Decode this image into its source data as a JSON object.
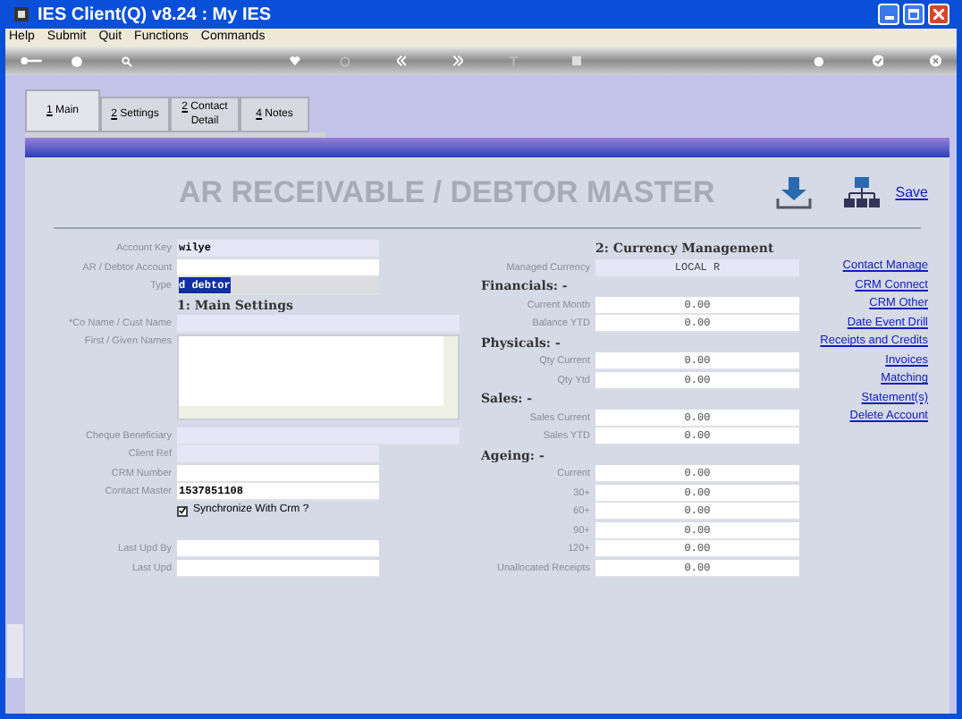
{
  "window": {
    "title": "IES Client(Q) v8.24 : My IES"
  },
  "menu": [
    "Help",
    "Submit",
    "Quit",
    "Functions",
    "Commands"
  ],
  "tabs": [
    {
      "label": "1 Main",
      "selected": true
    },
    {
      "label": "2 Settings",
      "selected": false
    },
    {
      "label": "2 Contact Detail",
      "selected": false
    },
    {
      "label": "4 Notes",
      "selected": false
    }
  ],
  "header": {
    "title": "AR RECEIVABLE / DEBTOR MASTER",
    "save_link": "Save"
  },
  "left_rows": [
    {
      "kind": "field",
      "label": "Account Key",
      "value": "wilye",
      "shaded": true
    },
    {
      "kind": "field",
      "label": "AR / Debtor Account",
      "value": "",
      "shaded": false
    },
    {
      "kind": "field",
      "label": "Type",
      "value": "d debtor",
      "shaded": false,
      "highlighted": true
    },
    {
      "kind": "heading",
      "label": "1: Main Settings"
    },
    {
      "kind": "field",
      "label": "*Co Name / Cust Name",
      "value": "",
      "shaded": true,
      "wide": true
    },
    {
      "kind": "textarea",
      "label": "First / Given Names"
    },
    {
      "kind": "field",
      "label": "Cheque Beneficiary",
      "value": "",
      "shaded": true,
      "wide": true
    },
    {
      "kind": "field",
      "label": "Client Ref",
      "value": "",
      "shaded": true
    },
    {
      "kind": "field",
      "label": "CRM Number",
      "value": "",
      "shaded": false
    },
    {
      "kind": "field",
      "label": "Contact Master",
      "value": "1537851108",
      "shaded": false
    },
    {
      "kind": "checkbox",
      "label": "Synchronize With Crm ?",
      "checked": true
    },
    {
      "kind": "gap"
    },
    {
      "kind": "field",
      "label": "Last Upd By",
      "value": "",
      "shaded": false
    },
    {
      "kind": "field",
      "label": "Last Upd",
      "value": "",
      "shaded": false
    }
  ],
  "right_rows": [
    {
      "kind": "heading",
      "label": "2: Currency Management"
    },
    {
      "kind": "field",
      "label": "Managed Currency",
      "value": "LOCAL R",
      "shaded": true
    },
    {
      "kind": "section",
      "label": "Financials: -"
    },
    {
      "kind": "field",
      "label": "Current Month",
      "value": "0.00",
      "shaded": false
    },
    {
      "kind": "field",
      "label": "Balance YTD",
      "value": "0.00",
      "shaded": false
    },
    {
      "kind": "section",
      "label": "Physicals: -"
    },
    {
      "kind": "field",
      "label": "Qty Current",
      "value": "0.00",
      "shaded": false
    },
    {
      "kind": "field",
      "label": "Qty Ytd",
      "value": "0.00",
      "shaded": false
    },
    {
      "kind": "section",
      "label": "Sales: -"
    },
    {
      "kind": "field",
      "label": "Sales Current",
      "value": "0.00",
      "shaded": false
    },
    {
      "kind": "field",
      "label": "Sales YTD",
      "value": "0.00",
      "shaded": false
    },
    {
      "kind": "section",
      "label": "Ageing: -"
    },
    {
      "kind": "field",
      "label": "Current",
      "value": "0.00",
      "shaded": false
    },
    {
      "kind": "field",
      "label": "30+",
      "value": "0.00",
      "shaded": false
    },
    {
      "kind": "field",
      "label": "60+",
      "value": "0.00",
      "shaded": false
    },
    {
      "kind": "field",
      "label": "90+",
      "value": "0.00",
      "shaded": false
    },
    {
      "kind": "field",
      "label": "120+",
      "value": "0.00",
      "shaded": false
    },
    {
      "kind": "field",
      "label": "Unallocated Receipts",
      "value": "0.00",
      "shaded": false
    }
  ],
  "links": [
    "Contact Manage",
    "CRM Connect",
    "CRM Other",
    "Date Event Drill",
    "Receipts and Credits",
    "Invoices",
    "Matching",
    "Statement(s)",
    "Delete Account"
  ]
}
